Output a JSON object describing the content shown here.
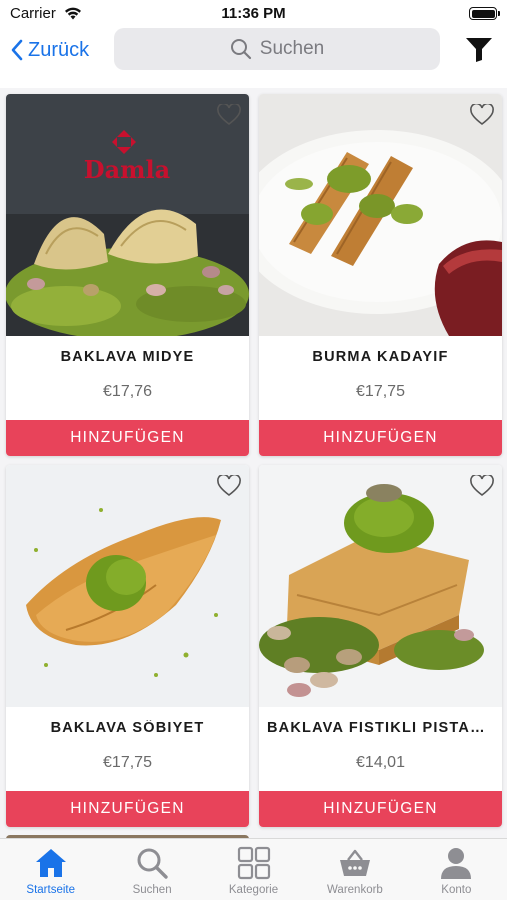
{
  "status_bar": {
    "carrier": "Carrier",
    "time": "11:36 PM",
    "icons": [
      "wifi-icon",
      "battery-icon"
    ]
  },
  "nav": {
    "back_label": "Zurück",
    "search_placeholder": "Suchen",
    "icons": [
      "chevron-left-icon",
      "search-icon",
      "filter-icon"
    ]
  },
  "products": [
    {
      "name": "BAKLAVA MIDYE",
      "price": "€17,76",
      "button": "HINZUFÜGEN",
      "image_logo_text": "Damla"
    },
    {
      "name": "BURMA KADAYIF",
      "price": "€17,75",
      "button": "HINZUFÜGEN"
    },
    {
      "name": "BAKLAVA SÖBIYET",
      "price": "€17,75",
      "button": "HINZUFÜGEN"
    },
    {
      "name": "BAKLAVA FISTIKLI PISTAZIE",
      "price": "€14,01",
      "button": "HINZUFÜGEN"
    }
  ],
  "tabs": [
    {
      "label": "Startseite",
      "icon": "home-icon",
      "active": true
    },
    {
      "label": "Suchen",
      "icon": "search-icon",
      "active": false
    },
    {
      "label": "Kategorie",
      "icon": "grid-icon",
      "active": false
    },
    {
      "label": "Warenkorb",
      "icon": "basket-icon",
      "active": false
    },
    {
      "label": "Konto",
      "icon": "person-icon",
      "active": false
    }
  ],
  "colors": {
    "accent": "#1a73e8",
    "add_button": "#e8435a",
    "inactive_tab": "#8e8e93"
  }
}
